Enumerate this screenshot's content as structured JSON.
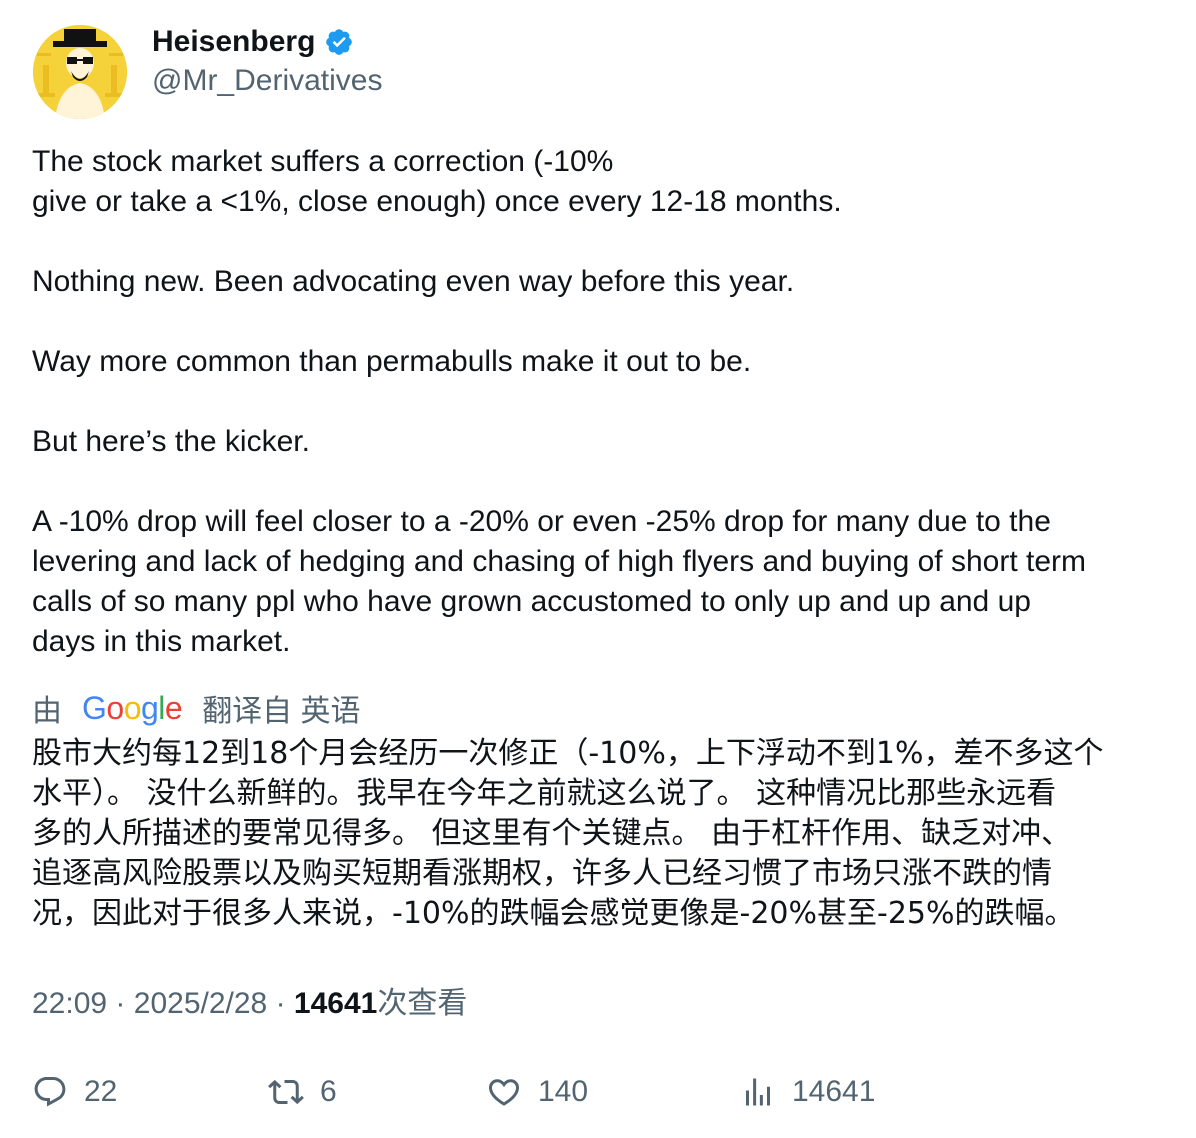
{
  "author": {
    "display_name": "Heisenberg",
    "handle": "@Mr_Derivatives",
    "verified": true
  },
  "tweet": {
    "lines": [
      "The stock market suffers a correction (-10%",
      "give or take a <1%, close enough) once every 12-18 months.",
      "",
      "Nothing new. Been advocating even way before this year.",
      "",
      "Way more common than permabulls make it out to be.",
      "",
      "But here’s the kicker.",
      "",
      "A -10% drop will feel closer to a -20% or even -25% drop for many due to the",
      "levering and lack of hedging and chasing of high flyers and buying of short term",
      "calls of so many ppl who have grown accustomed to only up and up and up",
      "days in this market."
    ]
  },
  "translation": {
    "prefix": "由",
    "provider": "Google",
    "suffix": "翻译自 英语",
    "lines": [
      "股市大约每12到18个月会经历一次修正（-10%，上下浮动不到1%，差不多这个",
      "水平）。 没什么新鲜的。我早在今年之前就这么说了。 这种情况比那些永远看",
      "多的人所描述的要常见得多。 但这里有个关键点。 由于杠杆作用、缺乏对冲、",
      "追逐高风险股票以及购买短期看涨期权，许多人已经习惯了市场只涨不跌的情",
      "况，因此对于很多人来说，-10%的跌幅会感觉更像是-20%甚至-25%的跌幅。"
    ]
  },
  "meta": {
    "time": "22:09",
    "date": "2025/2/28",
    "separator": "·",
    "views": "14641",
    "views_label": "次查看"
  },
  "actions": {
    "replies": "22",
    "retweets": "6",
    "likes": "140",
    "views": "14641"
  },
  "colors": {
    "verified": "#1d9bf0",
    "secondary_text": "#536471",
    "primary_text": "#0f1419",
    "avatar_bg": "#f6d23a"
  },
  "icons": [
    "verified-badge-icon",
    "reply-icon",
    "retweet-icon",
    "like-icon",
    "views-icon"
  ]
}
